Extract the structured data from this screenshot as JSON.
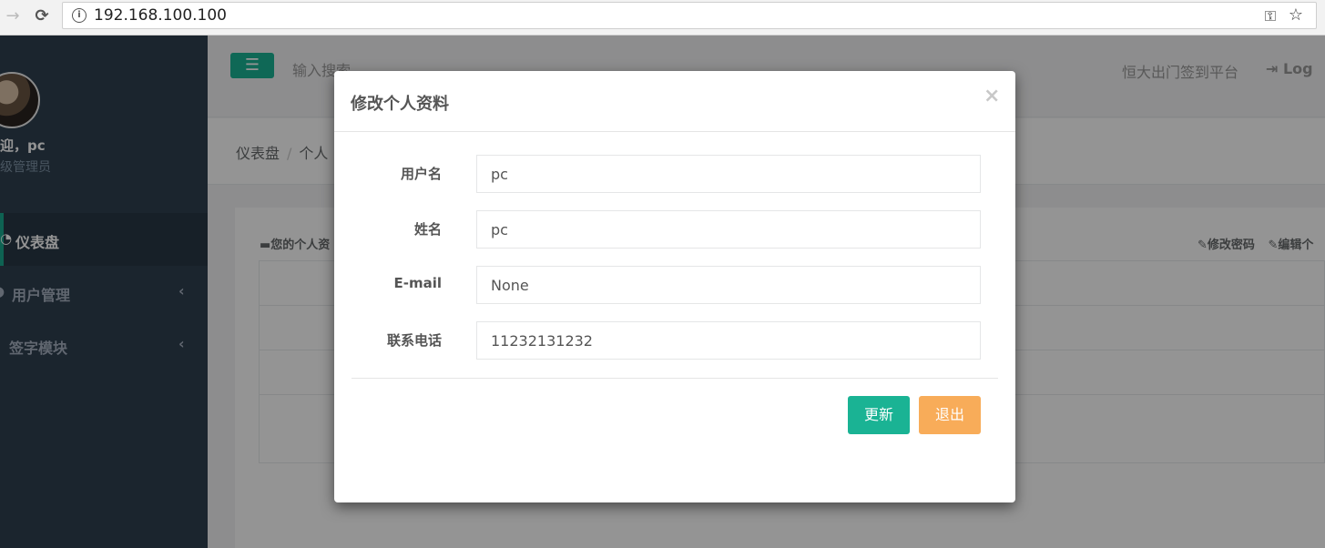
{
  "browser": {
    "url": "192.168.100.100",
    "back_icon": "→",
    "reload_icon": "C"
  },
  "topbar": {
    "search_placeholder": "输入搜索",
    "site_name": "恒大出门签到平台",
    "logout_label": "Log"
  },
  "sidebar": {
    "welcome": "迎，pc",
    "role": "级管理员",
    "items": [
      {
        "label": "仪表盘",
        "icon": "dashboard-icon"
      },
      {
        "label": "用户管理",
        "icon": "user-icon"
      },
      {
        "label": "签字模块",
        "icon": "sign-icon"
      }
    ]
  },
  "breadcrumb": {
    "home": "仪表盘",
    "separator": "/",
    "current": "个人"
  },
  "content": {
    "box_title": "您的个人资",
    "change_password": "修改密码",
    "edit": "编辑个"
  },
  "modal": {
    "title": "修改个人资料",
    "close": "×",
    "fields": [
      {
        "label": "用户名",
        "value": "pc"
      },
      {
        "label": "姓名",
        "value": "pc"
      },
      {
        "label": "E-mail",
        "value": "None"
      },
      {
        "label": "联系电话",
        "value": "11232131232"
      }
    ],
    "update_button": "更新",
    "exit_button": "退出"
  },
  "colors": {
    "primary": "#1ab394",
    "warning": "#f8ac59",
    "sidebar": "#2f4050"
  }
}
